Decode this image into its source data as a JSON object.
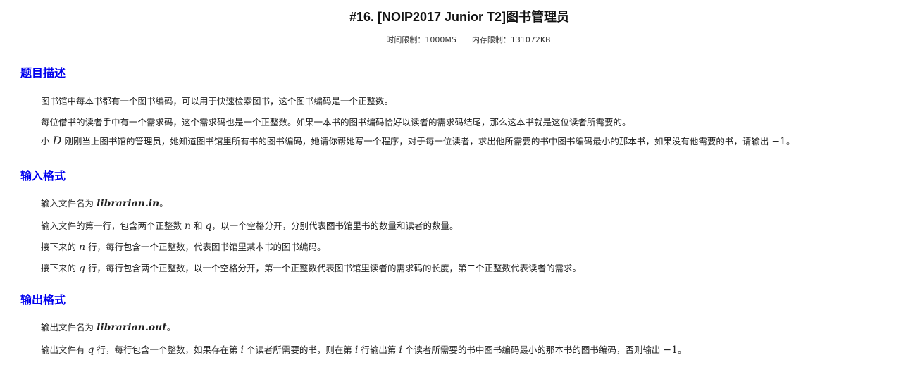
{
  "problem": {
    "title": "#16. [NOIP2017 Junior T2]图书管理员",
    "time_limit": "时间限制：1000MS",
    "memory_limit": "内存限制：131072KB"
  },
  "sections": {
    "description": {
      "heading": "题目描述",
      "p1": "图书馆中每本书都有一个图书编码，可以用于快速检索图书，这个图书编码是一个正整数。",
      "p2": "每位借书的读者手中有一个需求码，这个需求码也是一个正整数。如果一本书的图书编码恰好以读者的需求码结尾，那么这本书就是这位读者所需要的。",
      "p3_prefix": "小",
      "p3_var": "D",
      "p3_text": "刚刚当上图书馆的管理员，她知道图书馆里所有书的图书编码，她请你帮她写一个程序，对于每一位读者，求出他所需要的书中图书编码最小的那本书，如果没有他需要的书，请输出",
      "p3_value": "−1",
      "p3_end": "。"
    },
    "input": {
      "heading": "输入格式",
      "p1_prefix": "输入文件名为",
      "p1_file": "librarian.in",
      "p1_end": "。",
      "p2_a": "输入文件的第一行，包含两个正整数",
      "p2_n": "n",
      "p2_b": "和",
      "p2_q": "q",
      "p2_c": "，以一个空格分开，分别代表图书馆里书的数量和读者的数量。",
      "p3_a": "接下来的",
      "p3_n": "n",
      "p3_b": "行，每行包含一个正整数，代表图书馆里某本书的图书编码。",
      "p4_a": "接下来的",
      "p4_q": "q",
      "p4_b": "行，每行包含两个正整数，以一个空格分开，第一个正整数代表图书馆里读者的需求码的长度，第二个正整数代表读者的需求。"
    },
    "output": {
      "heading": "输出格式",
      "p1_prefix": "输出文件名为",
      "p1_file": "librarian.out",
      "p1_end": "。",
      "p2_a": "输出文件有",
      "p2_q": "q",
      "p2_b": "行，每行包含一个整数，如果存在第",
      "p2_i1": "i",
      "p2_c": "个读者所需要的书，则在第",
      "p2_i2": "i",
      "p2_d": "行输出第",
      "p2_i3": "i",
      "p2_e": "个读者所需要的书中图书编码最小的那本书的图书编码，否则输出",
      "p2_value": "−1",
      "p2_end": "。"
    }
  }
}
